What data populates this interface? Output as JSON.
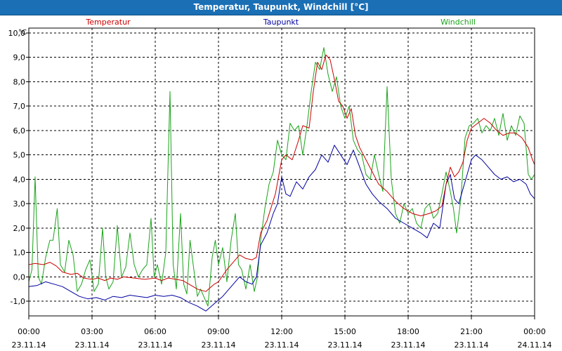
{
  "window": {
    "title": "Temperatur, Taupunkt, Windchill [°C]"
  },
  "chart_data": {
    "type": "line",
    "title": "Temperatur, Taupunkt, Windchill [°C]",
    "ylabel": "°C",
    "ylim": [
      -1.6,
      10.2
    ],
    "yticks": [
      "10,0",
      "9,0",
      "8,0",
      "7,0",
      "6,0",
      "5,0",
      "4,0",
      "3,0",
      "2,0",
      "1,0",
      "0,0",
      "-1,0"
    ],
    "ytick_values": [
      10,
      9,
      8,
      7,
      6,
      5,
      4,
      3,
      2,
      1,
      0,
      -1
    ],
    "xlim": [
      0,
      24
    ],
    "x_unit": "hours from 23.11.14 00:00",
    "xticks": [
      {
        "x": 0,
        "time": "00:00",
        "date": "23.11.14"
      },
      {
        "x": 3,
        "time": "03:00",
        "date": "23.11.14"
      },
      {
        "x": 6,
        "time": "06:00",
        "date": "23.11.14"
      },
      {
        "x": 9,
        "time": "09:00",
        "date": "23.11.14"
      },
      {
        "x": 12,
        "time": "12:00",
        "date": "23.11.14"
      },
      {
        "x": 15,
        "time": "15:00",
        "date": "23.11.14"
      },
      {
        "x": 18,
        "time": "18:00",
        "date": "23.11.14"
      },
      {
        "x": 21,
        "time": "21:00",
        "date": "23.11.14"
      },
      {
        "x": 24,
        "time": "00:00",
        "date": "24.11.14"
      }
    ],
    "grid": true,
    "legend_position": "top",
    "series": [
      {
        "name": "Temperatur",
        "color": "#cc0000",
        "points": [
          [
            0,
            0.5
          ],
          [
            0.3,
            0.55
          ],
          [
            0.7,
            0.5
          ],
          [
            1.0,
            0.6
          ],
          [
            1.3,
            0.45
          ],
          [
            1.6,
            0.2
          ],
          [
            2.0,
            0.1
          ],
          [
            2.3,
            0.15
          ],
          [
            2.6,
            -0.05
          ],
          [
            3.0,
            -0.1
          ],
          [
            3.3,
            -0.05
          ],
          [
            3.6,
            -0.15
          ],
          [
            3.9,
            -0.05
          ],
          [
            4.2,
            -0.1
          ],
          [
            4.5,
            0.0
          ],
          [
            5.0,
            -0.05
          ],
          [
            5.5,
            -0.1
          ],
          [
            6.0,
            -0.05
          ],
          [
            6.3,
            -0.15
          ],
          [
            6.6,
            -0.05
          ],
          [
            7.0,
            -0.1
          ],
          [
            7.3,
            -0.15
          ],
          [
            7.6,
            -0.3
          ],
          [
            8.0,
            -0.5
          ],
          [
            8.4,
            -0.6
          ],
          [
            8.8,
            -0.3
          ],
          [
            9.0,
            -0.2
          ],
          [
            9.4,
            0.3
          ],
          [
            9.7,
            0.6
          ],
          [
            10.0,
            0.9
          ],
          [
            10.3,
            0.75
          ],
          [
            10.6,
            0.7
          ],
          [
            10.8,
            0.8
          ],
          [
            11.0,
            1.8
          ],
          [
            11.3,
            2.3
          ],
          [
            11.7,
            3.4
          ],
          [
            12.0,
            4.8
          ],
          [
            12.2,
            5.0
          ],
          [
            12.5,
            4.8
          ],
          [
            12.8,
            5.6
          ],
          [
            13.0,
            6.2
          ],
          [
            13.3,
            6.1
          ],
          [
            13.5,
            7.6
          ],
          [
            13.7,
            8.8
          ],
          [
            13.9,
            8.5
          ],
          [
            14.1,
            9.1
          ],
          [
            14.3,
            8.9
          ],
          [
            14.5,
            8.1
          ],
          [
            14.7,
            7.2
          ],
          [
            14.9,
            7.0
          ],
          [
            15.1,
            6.5
          ],
          [
            15.3,
            6.9
          ],
          [
            15.5,
            5.8
          ],
          [
            15.7,
            5.3
          ],
          [
            16.0,
            4.8
          ],
          [
            16.3,
            4.3
          ],
          [
            16.6,
            3.8
          ],
          [
            17.0,
            3.5
          ],
          [
            17.4,
            3.1
          ],
          [
            17.8,
            2.8
          ],
          [
            18.2,
            2.6
          ],
          [
            18.6,
            2.5
          ],
          [
            19.0,
            2.6
          ],
          [
            19.3,
            2.7
          ],
          [
            19.6,
            2.9
          ],
          [
            19.8,
            3.8
          ],
          [
            20.0,
            4.5
          ],
          [
            20.2,
            4.1
          ],
          [
            20.4,
            4.3
          ],
          [
            20.6,
            4.7
          ],
          [
            20.8,
            5.6
          ],
          [
            21.0,
            6.1
          ],
          [
            21.3,
            6.3
          ],
          [
            21.6,
            6.5
          ],
          [
            21.9,
            6.3
          ],
          [
            22.2,
            6.0
          ],
          [
            22.5,
            5.8
          ],
          [
            22.8,
            5.9
          ],
          [
            23.1,
            5.9
          ],
          [
            23.4,
            5.7
          ],
          [
            23.7,
            5.3
          ],
          [
            23.9,
            4.8
          ],
          [
            24.0,
            4.6
          ]
        ]
      },
      {
        "name": "Taupunkt",
        "color": "#0000a0",
        "points": [
          [
            0,
            -0.4
          ],
          [
            0.4,
            -0.35
          ],
          [
            0.8,
            -0.2
          ],
          [
            1.2,
            -0.3
          ],
          [
            1.6,
            -0.4
          ],
          [
            2.0,
            -0.6
          ],
          [
            2.4,
            -0.8
          ],
          [
            2.8,
            -0.9
          ],
          [
            3.2,
            -0.85
          ],
          [
            3.6,
            -0.95
          ],
          [
            4.0,
            -0.8
          ],
          [
            4.4,
            -0.85
          ],
          [
            4.8,
            -0.75
          ],
          [
            5.2,
            -0.8
          ],
          [
            5.6,
            -0.85
          ],
          [
            6.0,
            -0.75
          ],
          [
            6.4,
            -0.8
          ],
          [
            6.8,
            -0.75
          ],
          [
            7.2,
            -0.85
          ],
          [
            7.6,
            -1.05
          ],
          [
            8.0,
            -1.2
          ],
          [
            8.4,
            -1.4
          ],
          [
            8.8,
            -1.1
          ],
          [
            9.2,
            -0.8
          ],
          [
            9.6,
            -0.4
          ],
          [
            10.0,
            0.0
          ],
          [
            10.3,
            -0.2
          ],
          [
            10.6,
            -0.3
          ],
          [
            10.8,
            0.0
          ],
          [
            11.0,
            1.3
          ],
          [
            11.3,
            1.8
          ],
          [
            11.6,
            2.6
          ],
          [
            11.8,
            3.0
          ],
          [
            12.0,
            4.1
          ],
          [
            12.2,
            3.4
          ],
          [
            12.4,
            3.3
          ],
          [
            12.7,
            3.9
          ],
          [
            13.0,
            3.6
          ],
          [
            13.3,
            4.1
          ],
          [
            13.6,
            4.4
          ],
          [
            13.9,
            5.0
          ],
          [
            14.2,
            4.7
          ],
          [
            14.5,
            5.4
          ],
          [
            14.8,
            5.0
          ],
          [
            15.1,
            4.6
          ],
          [
            15.4,
            5.2
          ],
          [
            15.7,
            4.5
          ],
          [
            16.0,
            3.8
          ],
          [
            16.3,
            3.4
          ],
          [
            16.6,
            3.1
          ],
          [
            17.0,
            2.8
          ],
          [
            17.4,
            2.4
          ],
          [
            17.8,
            2.2
          ],
          [
            18.2,
            2.0
          ],
          [
            18.6,
            1.8
          ],
          [
            18.9,
            1.6
          ],
          [
            19.2,
            2.2
          ],
          [
            19.5,
            2.0
          ],
          [
            19.8,
            3.8
          ],
          [
            20.0,
            4.2
          ],
          [
            20.2,
            3.2
          ],
          [
            20.4,
            3.0
          ],
          [
            20.6,
            3.6
          ],
          [
            20.8,
            4.2
          ],
          [
            21.0,
            4.8
          ],
          [
            21.2,
            5.0
          ],
          [
            21.5,
            4.8
          ],
          [
            21.8,
            4.5
          ],
          [
            22.1,
            4.2
          ],
          [
            22.4,
            4.0
          ],
          [
            22.7,
            4.1
          ],
          [
            23.0,
            3.9
          ],
          [
            23.3,
            4.0
          ],
          [
            23.6,
            3.8
          ],
          [
            23.8,
            3.4
          ],
          [
            24.0,
            3.2
          ]
        ]
      },
      {
        "name": "Windchill",
        "color": "#1aa31a",
        "points": [
          [
            0,
            -0.2
          ],
          [
            0.15,
            0.3
          ],
          [
            0.3,
            4.1
          ],
          [
            0.45,
            0.0
          ],
          [
            0.6,
            -0.3
          ],
          [
            0.8,
            0.8
          ],
          [
            1.0,
            1.5
          ],
          [
            1.15,
            1.5
          ],
          [
            1.35,
            2.8
          ],
          [
            1.5,
            0.5
          ],
          [
            1.7,
            0.2
          ],
          [
            1.9,
            1.5
          ],
          [
            2.1,
            0.9
          ],
          [
            2.3,
            -0.6
          ],
          [
            2.5,
            -0.3
          ],
          [
            2.7,
            0.3
          ],
          [
            2.9,
            0.7
          ],
          [
            3.1,
            -0.6
          ],
          [
            3.3,
            -0.3
          ],
          [
            3.5,
            2.0
          ],
          [
            3.65,
            0.0
          ],
          [
            3.8,
            -0.5
          ],
          [
            4.0,
            -0.2
          ],
          [
            4.2,
            2.1
          ],
          [
            4.4,
            0.0
          ],
          [
            4.6,
            0.4
          ],
          [
            4.8,
            1.8
          ],
          [
            5.0,
            0.5
          ],
          [
            5.2,
            0.0
          ],
          [
            5.4,
            0.3
          ],
          [
            5.6,
            0.5
          ],
          [
            5.8,
            2.4
          ],
          [
            5.95,
            0.0
          ],
          [
            6.1,
            0.5
          ],
          [
            6.3,
            -0.3
          ],
          [
            6.5,
            1.0
          ],
          [
            6.7,
            7.6
          ],
          [
            6.85,
            0.5
          ],
          [
            7.0,
            -0.5
          ],
          [
            7.2,
            2.6
          ],
          [
            7.35,
            -0.3
          ],
          [
            7.5,
            -0.7
          ],
          [
            7.65,
            1.5
          ],
          [
            7.8,
            0.5
          ],
          [
            8.0,
            -0.8
          ],
          [
            8.15,
            -0.5
          ],
          [
            8.3,
            -0.8
          ],
          [
            8.5,
            -1.2
          ],
          [
            8.7,
            0.8
          ],
          [
            8.85,
            1.5
          ],
          [
            9.0,
            0.5
          ],
          [
            9.2,
            1.2
          ],
          [
            9.4,
            -0.2
          ],
          [
            9.6,
            1.5
          ],
          [
            9.8,
            2.6
          ],
          [
            9.95,
            0.5
          ],
          [
            10.1,
            0.3
          ],
          [
            10.3,
            -0.5
          ],
          [
            10.5,
            0.5
          ],
          [
            10.7,
            -0.6
          ],
          [
            10.85,
            0.0
          ],
          [
            11.0,
            1.5
          ],
          [
            11.2,
            2.8
          ],
          [
            11.4,
            3.8
          ],
          [
            11.6,
            4.3
          ],
          [
            11.8,
            5.6
          ],
          [
            12.0,
            5.0
          ],
          [
            12.2,
            4.8
          ],
          [
            12.4,
            6.3
          ],
          [
            12.6,
            6.0
          ],
          [
            12.8,
            6.2
          ],
          [
            13.0,
            5.0
          ],
          [
            13.2,
            6.2
          ],
          [
            13.4,
            7.6
          ],
          [
            13.6,
            8.8
          ],
          [
            13.8,
            8.5
          ],
          [
            14.0,
            9.4
          ],
          [
            14.2,
            8.3
          ],
          [
            14.4,
            7.6
          ],
          [
            14.6,
            8.2
          ],
          [
            14.8,
            7.0
          ],
          [
            15.0,
            6.5
          ],
          [
            15.2,
            7.0
          ],
          [
            15.4,
            5.6
          ],
          [
            15.6,
            5.2
          ],
          [
            15.8,
            5.0
          ],
          [
            16.0,
            4.2
          ],
          [
            16.2,
            4.0
          ],
          [
            16.4,
            5.0
          ],
          [
            16.6,
            4.2
          ],
          [
            16.8,
            3.5
          ],
          [
            17.0,
            7.8
          ],
          [
            17.2,
            4.0
          ],
          [
            17.4,
            2.6
          ],
          [
            17.6,
            2.2
          ],
          [
            17.8,
            3.0
          ],
          [
            18.0,
            2.6
          ],
          [
            18.2,
            2.8
          ],
          [
            18.4,
            2.2
          ],
          [
            18.6,
            2.0
          ],
          [
            18.8,
            2.8
          ],
          [
            19.0,
            3.0
          ],
          [
            19.2,
            2.4
          ],
          [
            19.4,
            2.6
          ],
          [
            19.6,
            3.4
          ],
          [
            19.8,
            4.3
          ],
          [
            20.0,
            3.5
          ],
          [
            20.15,
            2.8
          ],
          [
            20.3,
            1.8
          ],
          [
            20.5,
            3.2
          ],
          [
            20.7,
            5.7
          ],
          [
            20.9,
            6.2
          ],
          [
            21.1,
            6.3
          ],
          [
            21.3,
            6.5
          ],
          [
            21.5,
            5.9
          ],
          [
            21.7,
            6.2
          ],
          [
            21.9,
            6.0
          ],
          [
            22.1,
            6.5
          ],
          [
            22.3,
            5.8
          ],
          [
            22.5,
            6.7
          ],
          [
            22.7,
            5.6
          ],
          [
            22.9,
            6.2
          ],
          [
            23.1,
            5.8
          ],
          [
            23.3,
            6.6
          ],
          [
            23.5,
            6.3
          ],
          [
            23.7,
            4.2
          ],
          [
            23.85,
            4.0
          ],
          [
            24.0,
            4.2
          ]
        ]
      }
    ]
  }
}
